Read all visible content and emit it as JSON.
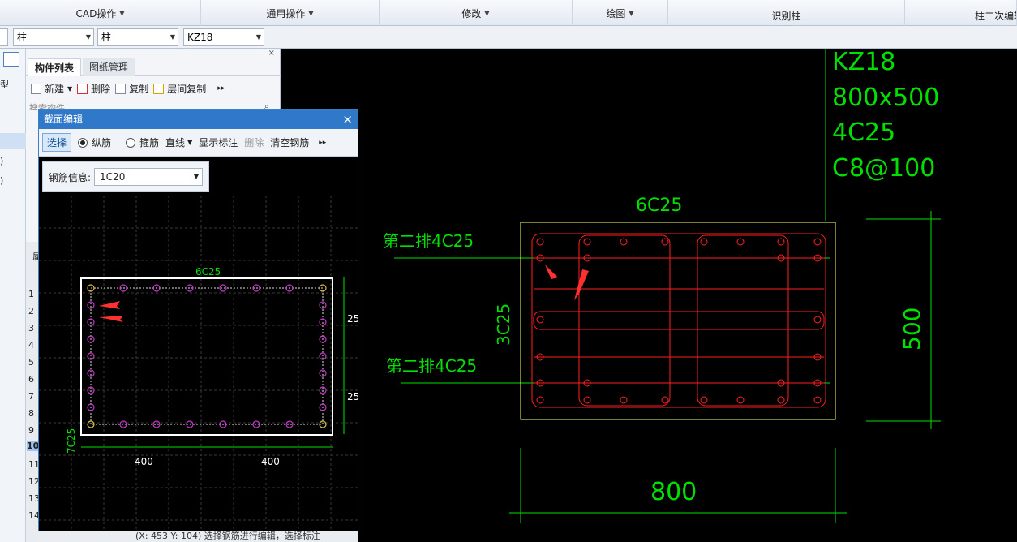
{
  "ribbon": {
    "groups": [
      {
        "label": "CAD操作",
        "has_menu": true
      },
      {
        "label": "通用操作",
        "has_menu": true
      },
      {
        "label": "修改",
        "has_menu": true
      },
      {
        "label": "绘图",
        "has_menu": true
      },
      {
        "label": "识别柱",
        "has_menu": false
      },
      {
        "label": "柱二次编辑",
        "has_menu": false
      }
    ]
  },
  "selectors": {
    "category": "柱",
    "subcategory": "柱",
    "component": "KZ18"
  },
  "left_strip": {
    "labels": [
      "型",
      ")",
      ")"
    ],
    "row_header": "属",
    "row_numbers": [
      "1",
      "2",
      "3",
      "4",
      "5",
      "6",
      "7",
      "8",
      "9",
      "10",
      "11",
      "12",
      "13",
      "14"
    ]
  },
  "component_panel": {
    "tabs": [
      "构件列表",
      "图纸管理"
    ],
    "tools": [
      "新建",
      "删除",
      "复制",
      "层间复制"
    ],
    "search_placeholder": "搜索构件..."
  },
  "section_editor": {
    "title": "截面编辑",
    "tools": {
      "select": "选择",
      "longitudinal": "纵筋",
      "stirrup": "箍筋",
      "line": "直线",
      "show_dims": "显示标注",
      "delete": "删除",
      "clear": "清空钢筋"
    },
    "rebar_info_label": "钢筋信息:",
    "rebar_info_value": "1C20",
    "top_bars_label": "6C25",
    "side_bars_label": "7C25",
    "dim_left": "400",
    "dim_right": "400",
    "dim_side_1": "25",
    "dim_side_2": "25",
    "status_text": "(X: 453 Y: 104) 选择钢筋进行编辑，选择标注"
  },
  "cad_drawing": {
    "title_lines": [
      "KZ18",
      "800x500",
      "4C25",
      "C8@100"
    ],
    "top_label": "6C25",
    "second_row_top": "第二排4C25",
    "second_row_bottom": "第二排4C25",
    "side_label": "3C25",
    "height_dim": "500",
    "width_dim": "800"
  },
  "colors": {
    "cad_green": "#00e000",
    "cad_red": "#ff2020",
    "cad_yellow": "#ffff66",
    "editor_rebar": "#cc33cc",
    "ribbon_bg": "#e3e9f2",
    "dialog_title": "#3079c9"
  }
}
